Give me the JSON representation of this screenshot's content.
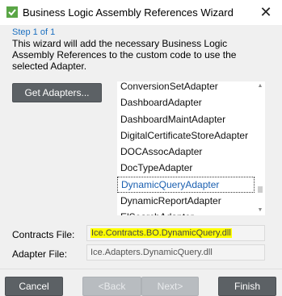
{
  "window": {
    "title": "Business Logic Assembly References Wizard"
  },
  "wizard": {
    "step": "Step 1 of 1",
    "description": "This wizard will add the necessary Business Logic Assembly References to the custom code to use the selected Adapter."
  },
  "get_adapters_label": "Get Adapters...",
  "adapters": {
    "items": [
      "ConversionSetAdapter",
      "DashboardAdapter",
      "DashboardMaintAdapter",
      "DigitalCertificateStoreAdapter",
      "DOCAssocAdapter",
      "DocTypeAdapter",
      "DynamicQueryAdapter",
      "DynamicReportAdapter",
      "ElSearchAdapter"
    ],
    "selected": "DynamicQueryAdapter"
  },
  "contracts": {
    "label": "Contracts File:",
    "value": "Ice.Contracts.BO.DynamicQuery.dll"
  },
  "adapter_file": {
    "label": "Adapter File:",
    "value": "Ice.Adapters.DynamicQuery.dll"
  },
  "footer": {
    "cancel": "Cancel",
    "back": "<Back",
    "next": "Next>",
    "finish": "Finish"
  },
  "colors": {
    "button": "#5c6165",
    "step_text": "#1a6fc0",
    "highlight": "#ffff00"
  }
}
